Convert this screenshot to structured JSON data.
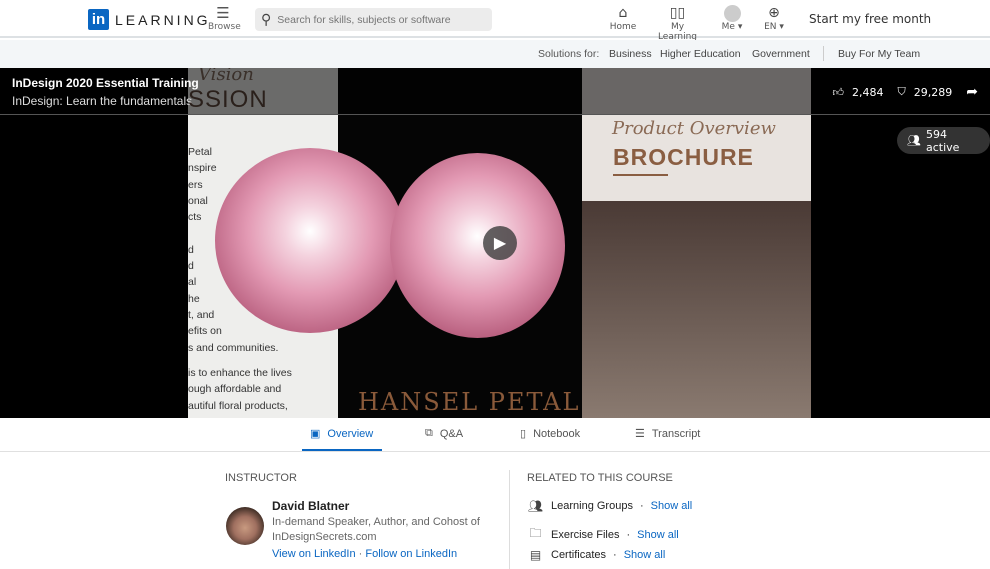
{
  "header": {
    "logo_text": "LEARNING",
    "logo_mark": "in",
    "browse": "Browse",
    "search_placeholder": "Search for skills, subjects or software",
    "nav": [
      {
        "label": "Home",
        "icon": "home-icon"
      },
      {
        "label": "My Learning",
        "icon": "book-icon"
      },
      {
        "label": "Me ▾",
        "icon": "avatar"
      },
      {
        "label": "EN ▾",
        "icon": "globe-icon"
      }
    ],
    "cta": "Start my free month"
  },
  "subnav": {
    "label": "Solutions for:",
    "links": [
      "Business",
      "Higher Education",
      "Government"
    ],
    "team": "Buy For My Team"
  },
  "video": {
    "title": "InDesign 2020 Essential Training",
    "subtitle": "InDesign: Learn the fundamentals",
    "likes": "2,484",
    "saves": "29,289",
    "active": "594 active",
    "frame": {
      "left_heading_italic": "Vision",
      "left_heading": "SSION",
      "left_lines": [
        "Petal",
        "nspire",
        "ers",
        "onal",
        "cts",
        "",
        "d",
        "d",
        "al",
        "he",
        "t, and",
        "efits on",
        "s and communities."
      ],
      "left_lines2": [
        "is to enhance the lives",
        "ough affordable and",
        "autiful floral products,"
      ],
      "brand": "HANSEL PETAL",
      "right_script": "Product Overview",
      "right_heading": "BROCHURE"
    }
  },
  "tabs": [
    {
      "label": "Overview",
      "active": true
    },
    {
      "label": "Q&A"
    },
    {
      "label": "Notebook"
    },
    {
      "label": "Transcript"
    }
  ],
  "instructor": {
    "heading": "INSTRUCTOR",
    "name": "David Blatner",
    "bio1": "In-demand Speaker, Author, and Cohost of",
    "bio2": "InDesignSecrets.com",
    "view": "View on LinkedIn",
    "sep": "·",
    "follow": "Follow on LinkedIn"
  },
  "related": {
    "heading": "RELATED TO THIS COURSE",
    "items": [
      {
        "label": "Learning Groups",
        "link": "Show all"
      },
      {
        "label": "Exercise Files",
        "link": "Show all"
      },
      {
        "label": "Certificates",
        "link": "Show all"
      }
    ]
  },
  "colors": {
    "accent": "#0a66c2"
  }
}
